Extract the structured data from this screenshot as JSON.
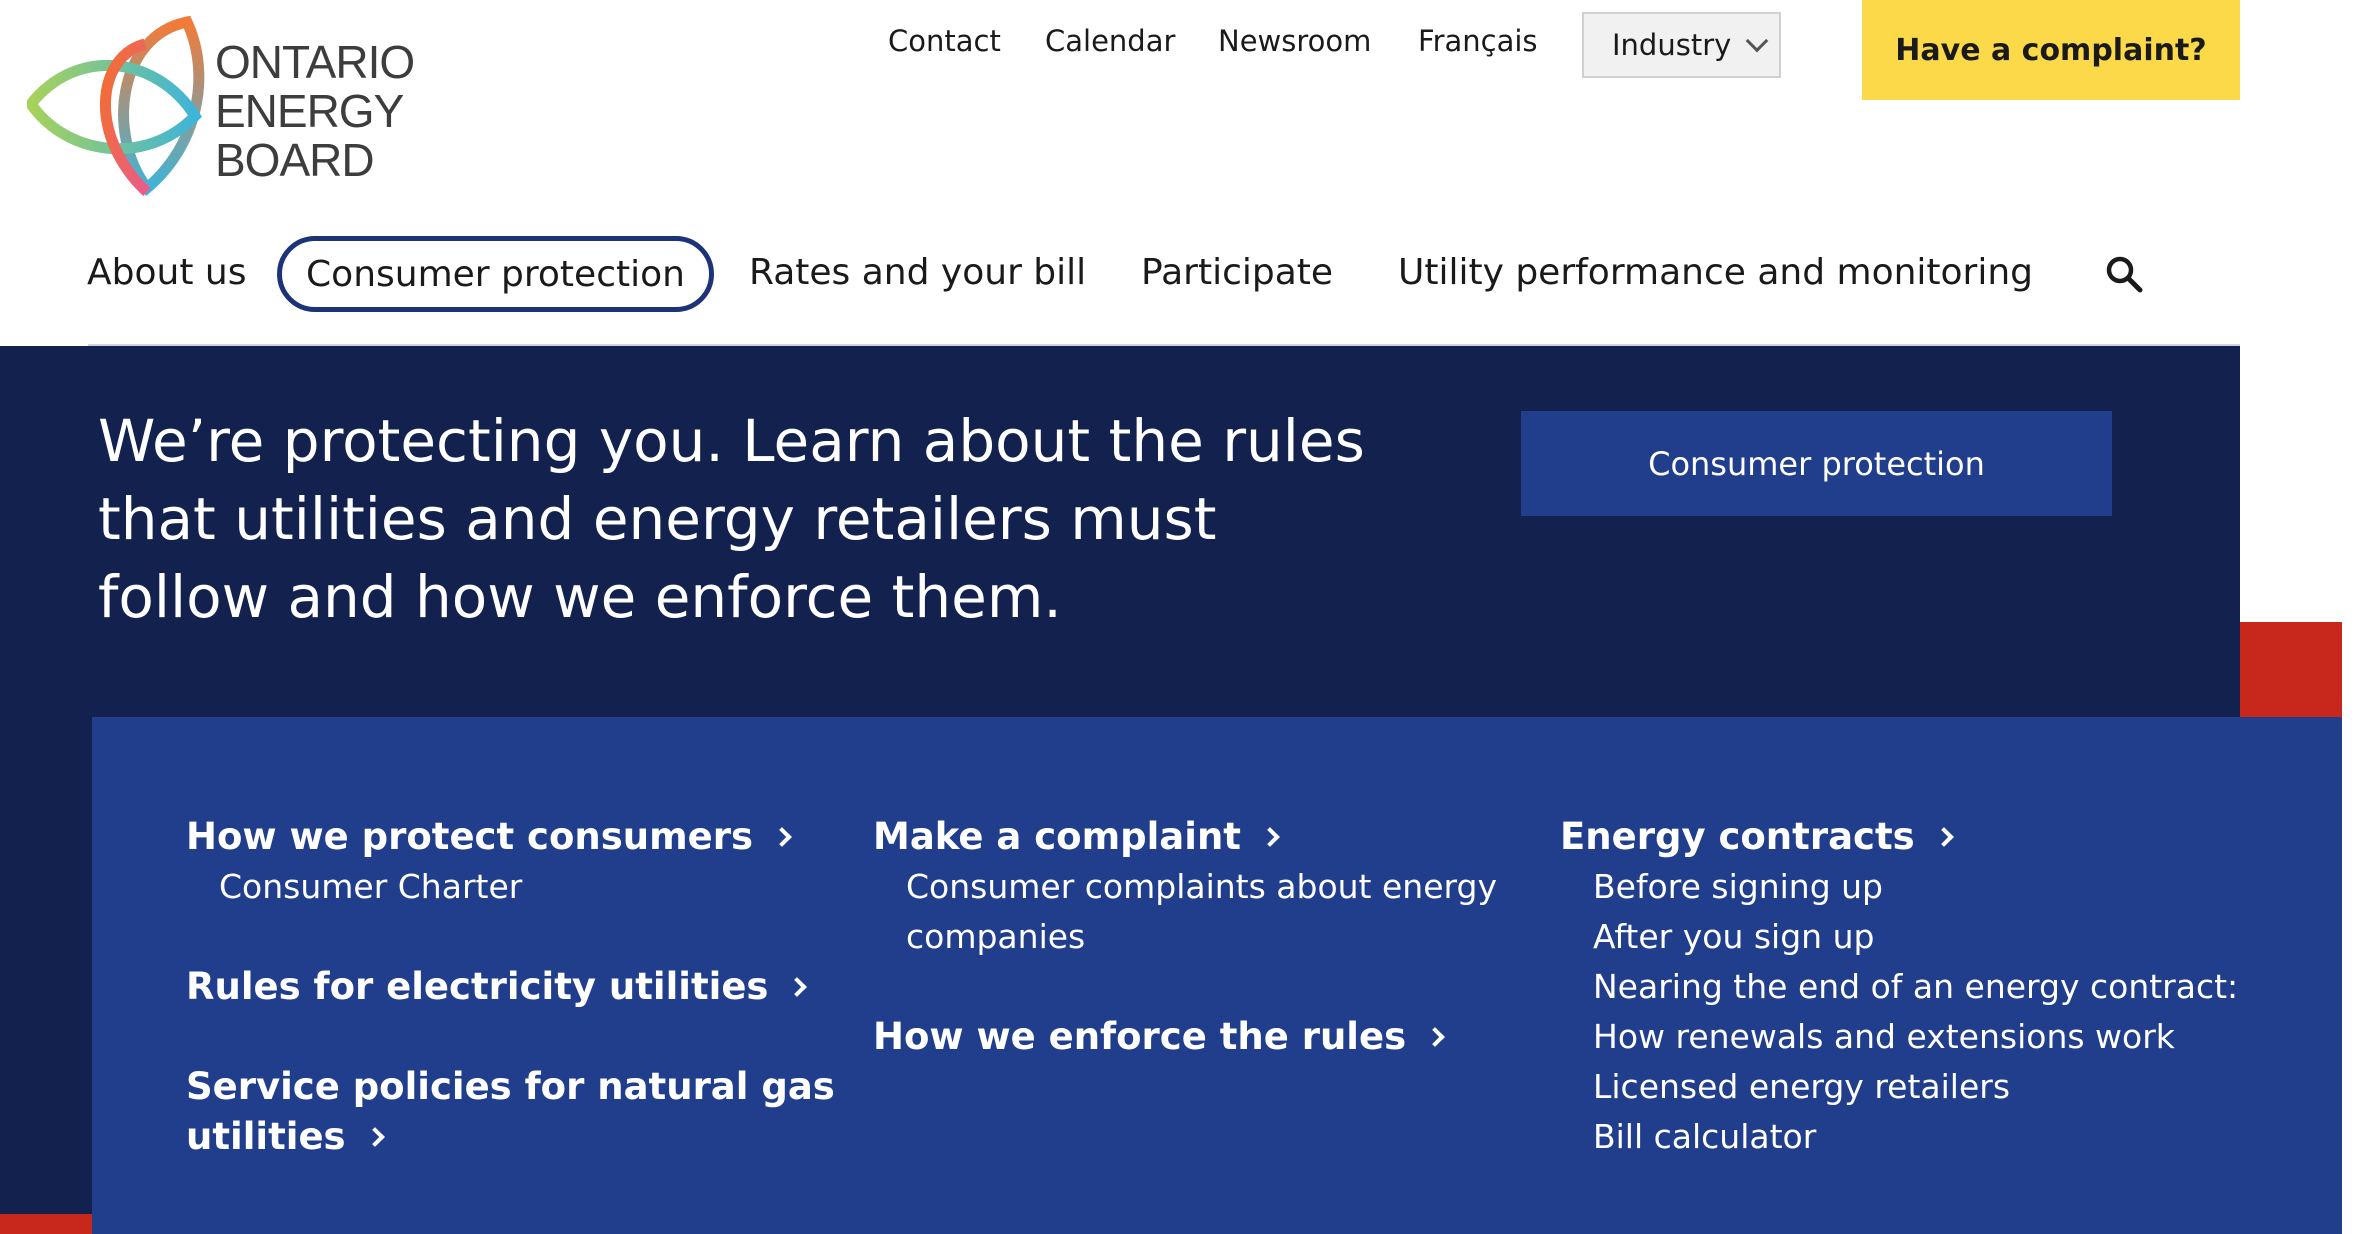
{
  "brand": {
    "name_lines": [
      "ONTARIO",
      "ENERGY",
      "BOARD"
    ]
  },
  "utility_nav": {
    "links": [
      "Contact",
      "Calendar",
      "Newsroom",
      "Français"
    ],
    "industry_label": "Industry",
    "complaint_label": "Have a complaint?"
  },
  "main_nav": {
    "items": [
      "About us",
      "Consumer protection",
      "Rates and your bill",
      "Participate",
      "Utility performance and monitoring"
    ],
    "active": "Consumer protection"
  },
  "hero": {
    "text": "We’re protecting you. Learn about the rules that utilities and energy retailers must follow and how we enforce them.",
    "button_label": "Consumer protection"
  },
  "mega_menu": {
    "col1": {
      "heading1": "How we protect consumers",
      "sub1": [
        "Consumer Charter"
      ],
      "heading2": "Rules for electricity utilities",
      "heading3_line1": "Service policies for natural gas",
      "heading3_line2": "utilities"
    },
    "col2": {
      "heading1": "Make a complaint",
      "sub1": [
        "Consumer complaints about energy",
        "companies"
      ],
      "heading2": "How we enforce the rules"
    },
    "col3": {
      "heading1": "Energy contracts",
      "sub": [
        "Before signing up",
        "After you sign up",
        "Nearing the end of an energy contract:",
        "How renewals and extensions work",
        "Licensed energy retailers",
        "Bill calculator"
      ]
    }
  },
  "colors": {
    "navy": "#12214d",
    "royal": "#213e8c",
    "yellow": "#fcd949",
    "red": "#c8281b"
  },
  "icons": {
    "search": "search-icon",
    "dropdown": "chevron-down-icon",
    "chevron": "chevron-right-icon"
  }
}
